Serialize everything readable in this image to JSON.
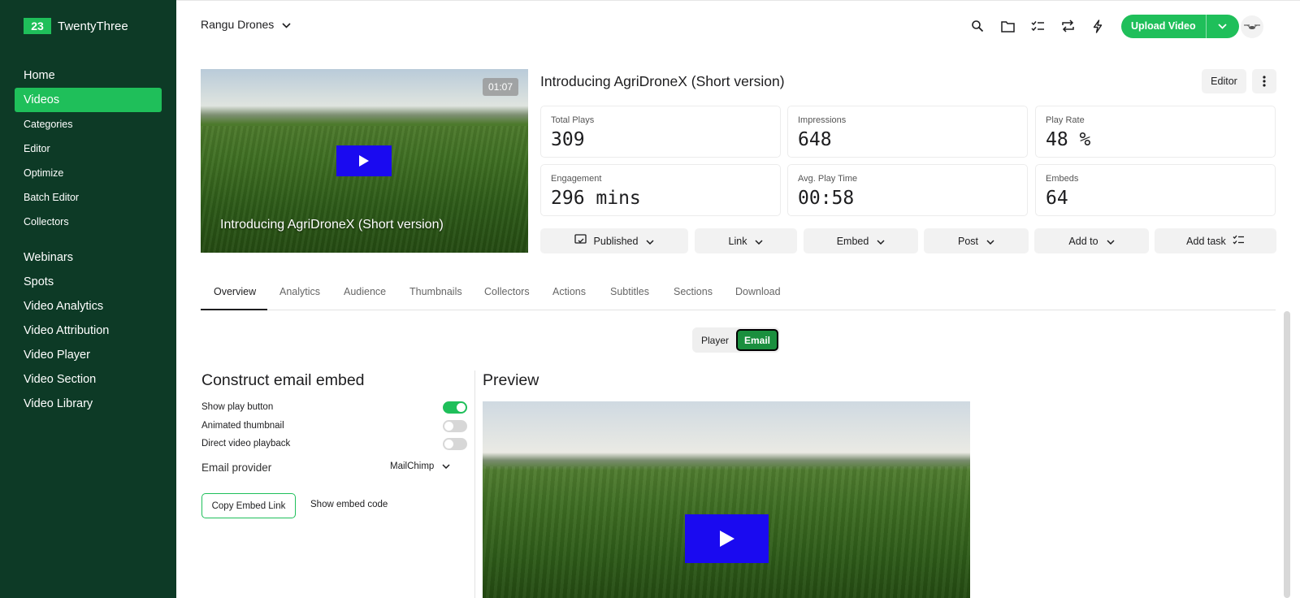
{
  "app": {
    "logo_number": "23",
    "logo_name": "TwentyThree"
  },
  "sidebar": {
    "main": [
      {
        "label": "Home",
        "size": "big"
      },
      {
        "label": "Videos",
        "size": "big",
        "active": true
      },
      {
        "label": "Categories",
        "size": "small"
      },
      {
        "label": "Editor",
        "size": "small"
      },
      {
        "label": "Optimize",
        "size": "small"
      },
      {
        "label": "Batch Editor",
        "size": "small"
      },
      {
        "label": "Collectors",
        "size": "small"
      }
    ],
    "secondary": [
      {
        "label": "Webinars"
      },
      {
        "label": "Spots"
      },
      {
        "label": "Video Analytics"
      },
      {
        "label": "Video Attribution"
      },
      {
        "label": "Video Player"
      },
      {
        "label": "Video Section"
      },
      {
        "label": "Video Library"
      }
    ]
  },
  "header": {
    "workspace": "Rangu Drones",
    "icons": [
      "search-icon",
      "folder-icon",
      "checklist-icon",
      "repeat-icon",
      "lightning-icon"
    ],
    "upload_label": "Upload Video"
  },
  "video": {
    "duration": "01:07",
    "thumb_title": "Introducing AgriDroneX (Short version)",
    "title": "Introducing AgriDroneX (Short version)",
    "editor_label": "Editor"
  },
  "stats": [
    {
      "label": "Total Plays",
      "value": "309"
    },
    {
      "label": "Impressions",
      "value": "648"
    },
    {
      "label": "Play Rate",
      "value": "48 %"
    },
    {
      "label": "Engagement",
      "value": "296 mins"
    },
    {
      "label": "Avg. Play Time",
      "value": "00:58"
    },
    {
      "label": "Embeds",
      "value": "64"
    }
  ],
  "actions": [
    {
      "label": "Published"
    },
    {
      "label": "Link"
    },
    {
      "label": "Embed"
    },
    {
      "label": "Post"
    },
    {
      "label": "Add to"
    },
    {
      "label": "Add task"
    }
  ],
  "tabs": [
    "Overview",
    "Analytics",
    "Audience",
    "Thumbnails",
    "Collectors",
    "Actions",
    "Subtitles",
    "Sections",
    "Download"
  ],
  "active_tab": "Overview",
  "segment": {
    "player": "Player",
    "email": "Email",
    "selected": "Email"
  },
  "email_embed": {
    "title": "Construct email embed",
    "options": [
      {
        "label": "Show play button",
        "on": true
      },
      {
        "label": "Animated thumbnail",
        "on": false
      },
      {
        "label": "Direct video playback",
        "on": false
      }
    ],
    "provider_label": "Email provider",
    "provider_value": "MailChimp",
    "copy_label": "Copy Embed Link",
    "show_code_label": "Show embed code"
  },
  "preview": {
    "title": "Preview"
  },
  "colors": {
    "sidebar": "#0d3a26",
    "accent": "#1fbf5a",
    "play": "#1a0af0",
    "email_selected": "#1a8f3e"
  }
}
